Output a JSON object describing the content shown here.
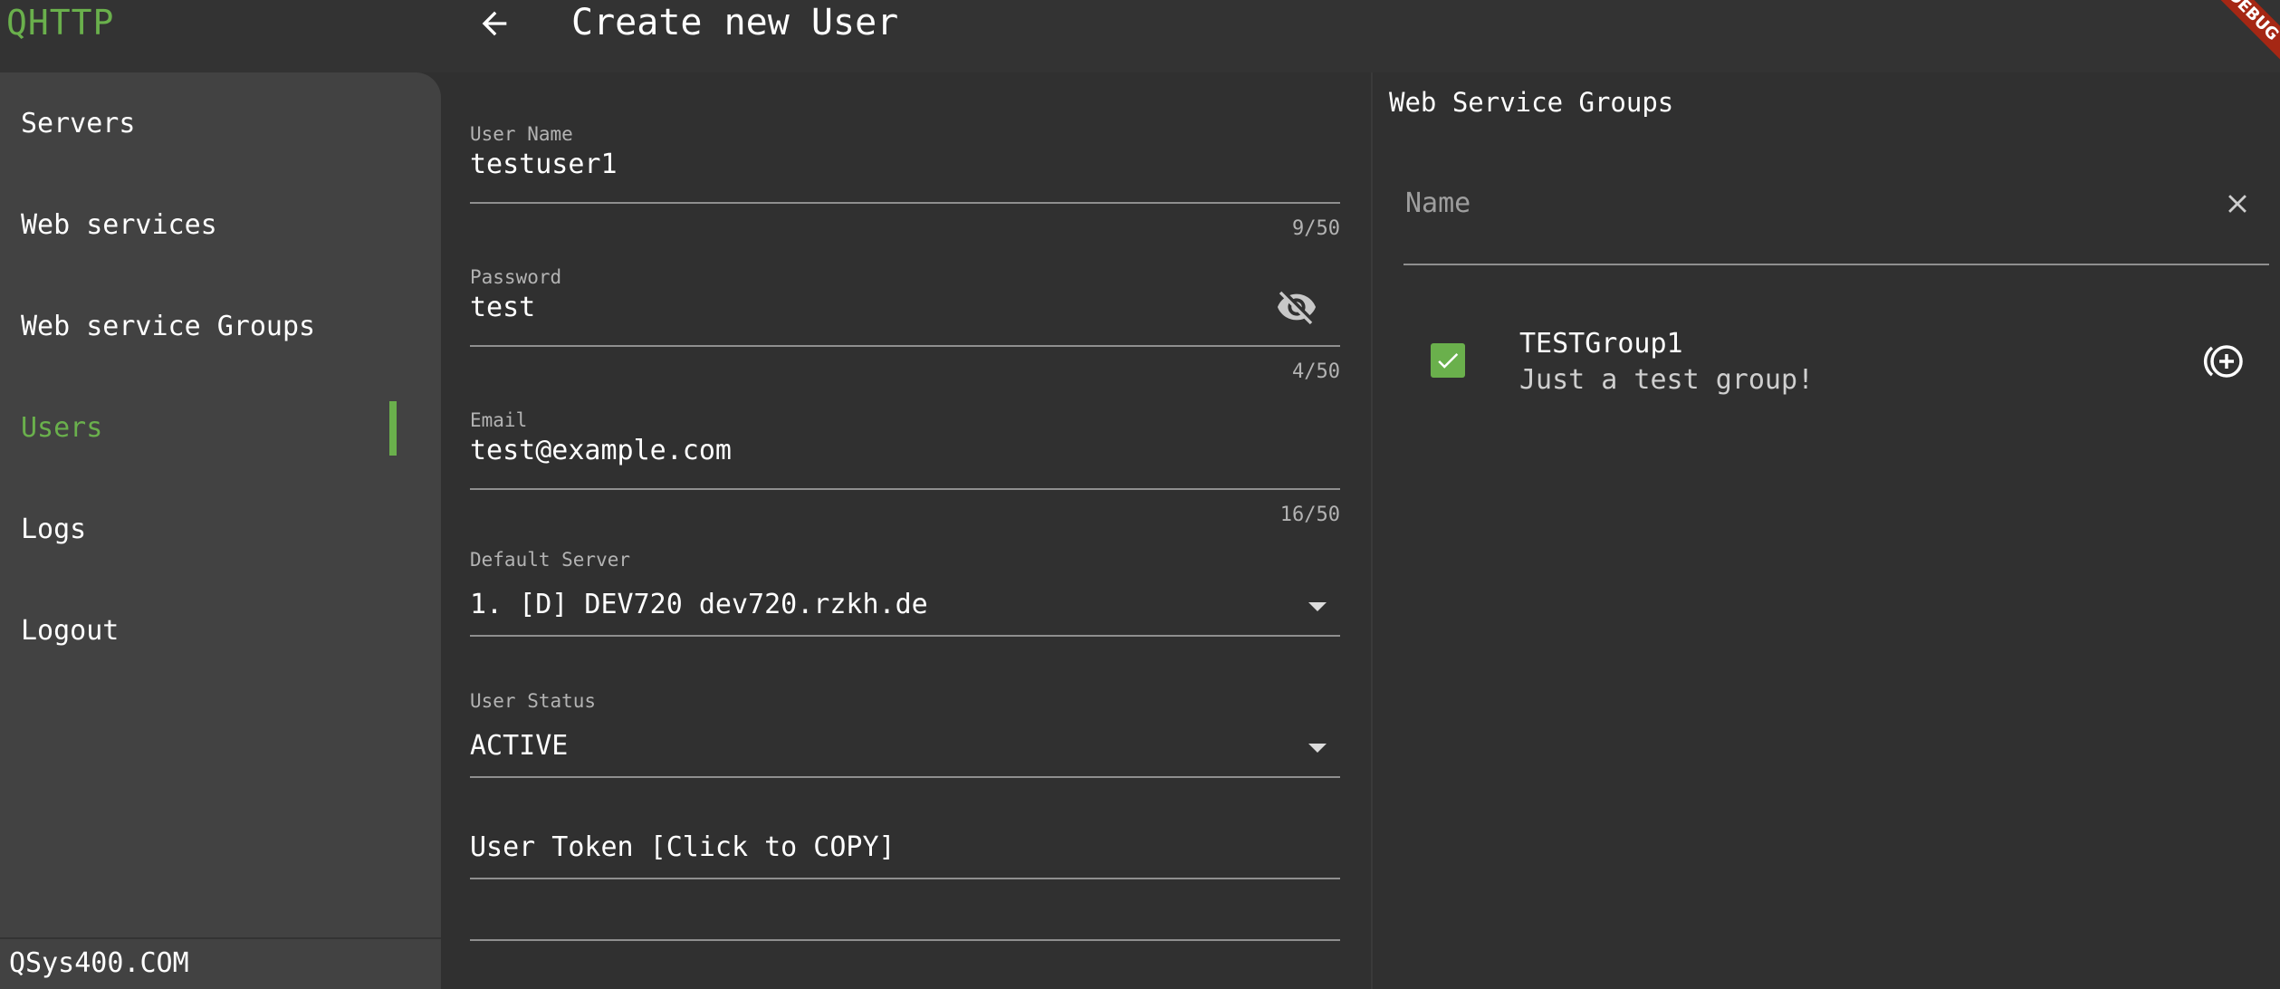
{
  "app": {
    "title": "QHTTP",
    "debug_banner": "DEBUG"
  },
  "header": {
    "title": "Create new User"
  },
  "colors": {
    "accent": "#6ab04c",
    "background": "#303030",
    "sidebar": "#424242",
    "debug": "#a52714"
  },
  "sidebar": {
    "items": [
      {
        "label": "Servers"
      },
      {
        "label": "Web services"
      },
      {
        "label": "Web service Groups"
      },
      {
        "label": "Users",
        "active": true
      },
      {
        "label": "Logs"
      },
      {
        "label": "Logout"
      }
    ],
    "footer": "QSys400.COM"
  },
  "form": {
    "username": {
      "label": "User Name",
      "value": "testuser1",
      "counter": "9/50"
    },
    "password": {
      "label": "Password",
      "value": "test",
      "counter": "4/50",
      "icon": "eye-off-icon"
    },
    "email": {
      "label": "Email",
      "value": "test@example.com",
      "counter": "16/50"
    },
    "default_server": {
      "label": "Default Server",
      "value": "1. [D] DEV720 dev720.rzkh.de"
    },
    "user_status": {
      "label": "User Status",
      "value": "ACTIVE"
    },
    "user_token": {
      "label": "User Token [Click to COPY]"
    }
  },
  "groups_panel": {
    "title": "Web Service Groups",
    "search": {
      "placeholder": "Name",
      "value": ""
    },
    "items": [
      {
        "name": "TESTGroup1",
        "description": "Just a test group!",
        "checked": true
      }
    ]
  }
}
